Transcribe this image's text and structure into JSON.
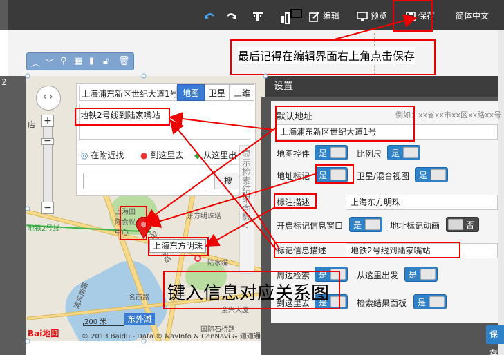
{
  "toolbar": {
    "edit_label": "编辑",
    "preview_label": "预览",
    "save_label": "保存",
    "language_label": "简体中文"
  },
  "gutter_number": "2",
  "map": {
    "address_input": "上海浦东新区世纪大道1号",
    "map_types": [
      "地图",
      "卫星",
      "三维"
    ],
    "description_text": "地铁2号线到陆家嘴站",
    "nav_tabs": [
      "在附近找",
      "到这里去",
      "从这里出"
    ],
    "search_button": "搜",
    "side_panel_text": "显示检索结果面板<",
    "pin_label": "上海东方明珠",
    "district_badge": "东外滩",
    "scale_label": "200 米",
    "baidu_logo": "Bai地图",
    "copyright": "© 2013 Baidu - Data © NavInfo & CenNavi & 道道通",
    "place_labels": [
      "上海国际会议中心",
      "东方明珠塔",
      "陆家嘴",
      "陆家嘴环路",
      "名商路",
      "浦东南路",
      "全兴大厦",
      "国际石桥路",
      "地铁2号线",
      "店"
    ]
  },
  "dialog": {
    "title": "设置",
    "default_address_label": "默认地址",
    "example_text": "例如：xx省xx市xx区xx路xx号",
    "default_address_value": "上海浦东新区世纪大道1号",
    "map_controls_label": "地图控件",
    "scale_label": "比例尺",
    "address_marker_label": "地址标记",
    "satellite_mix_label": "卫星/混合视图",
    "marker_desc_label": "标注描述",
    "marker_desc_value": "上海东方明珠",
    "open_marker_window_label": "开启标记信息窗口",
    "marker_animation_label": "地址标记动画",
    "marker_info_desc_label": "标记信息描述",
    "marker_info_desc_value": "地铁2号线到陆家嘴站",
    "nearby_search_label": "周边检索",
    "from_here_label": "从这里出发",
    "to_here_label": "到这里去",
    "result_panel_label": "检索结果面板",
    "toggle_on": "是",
    "toggle_off": "否",
    "save_button": "保存"
  },
  "annotations": {
    "save_note": "最后记得在编辑界面右上角点击保存",
    "relation_note": "键入信息对应关系图"
  },
  "colors": {
    "annotation_red": "#e00000",
    "toggle_blue": "#2f82c7",
    "toolbar_dark": "#3a3a3a"
  }
}
